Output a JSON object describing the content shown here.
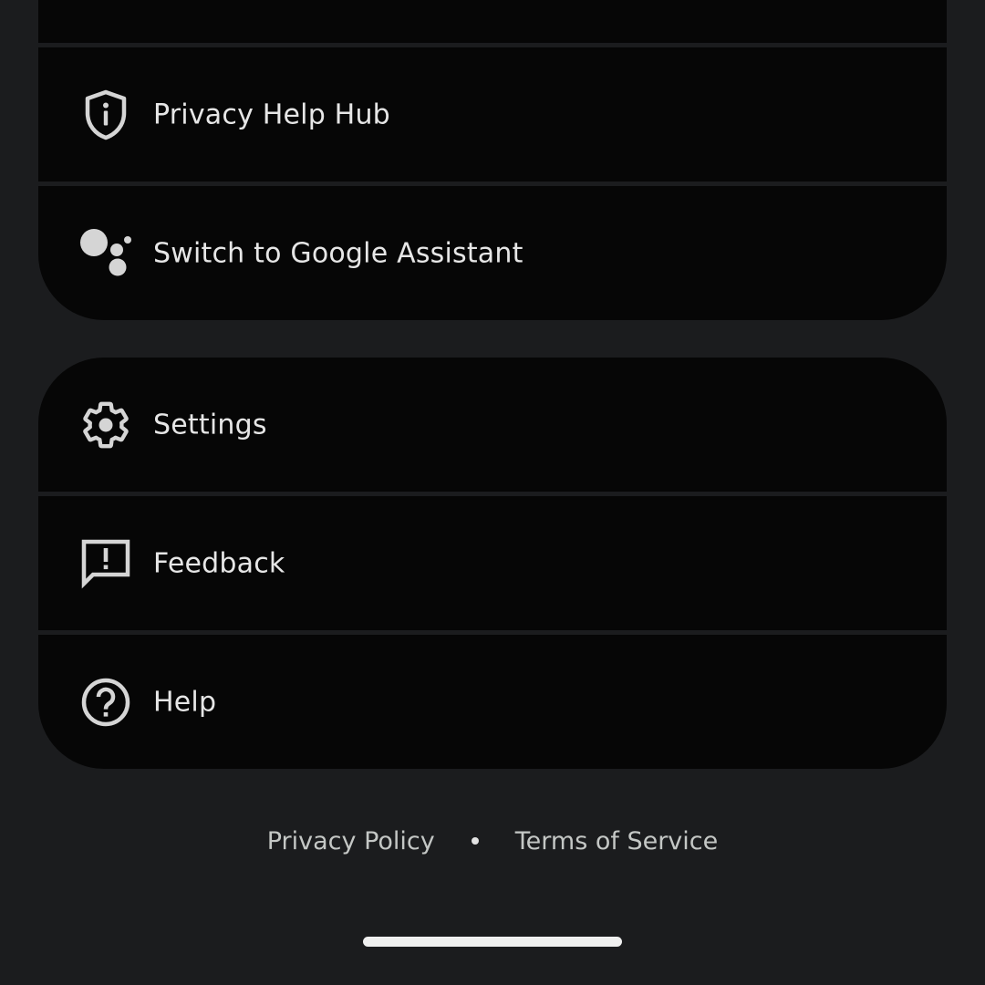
{
  "menu_top": [
    {
      "id": "item-above",
      "label": ""
    },
    {
      "id": "privacy-help-hub",
      "label": "Privacy Help Hub"
    },
    {
      "id": "switch-to-google-assistant",
      "label": "Switch to Google Assistant"
    }
  ],
  "menu_bottom": [
    {
      "id": "settings",
      "label": "Settings"
    },
    {
      "id": "feedback",
      "label": "Feedback"
    },
    {
      "id": "help",
      "label": "Help"
    }
  ],
  "footer": {
    "privacy_policy": "Privacy Policy",
    "terms_of_service": "Terms of Service"
  },
  "colors": {
    "background": "#1b1c1e",
    "card": "#060606",
    "text": "#e6e6e6",
    "icon": "#d5d5d5"
  }
}
